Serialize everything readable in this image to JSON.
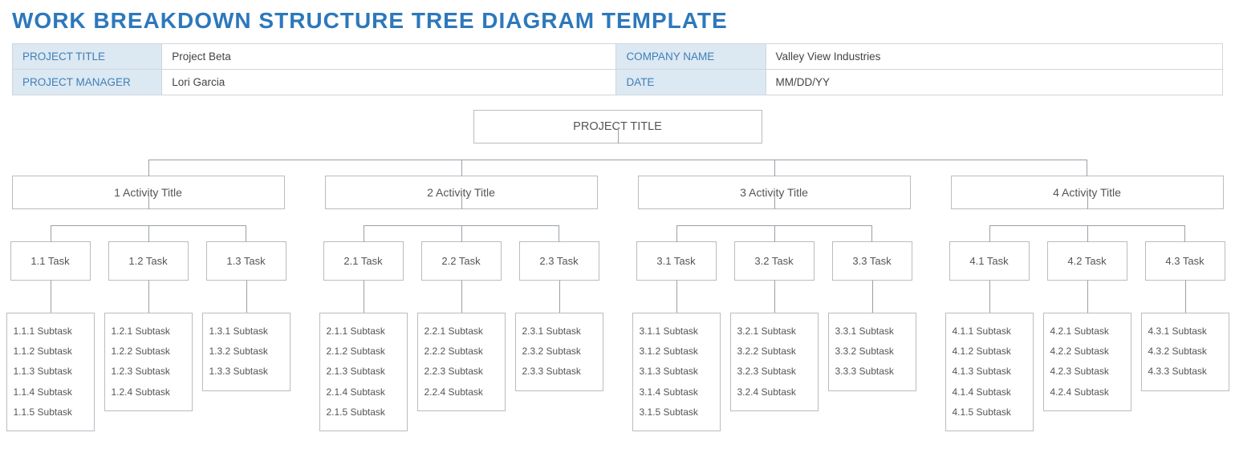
{
  "title": "WORK BREAKDOWN STRUCTURE TREE DIAGRAM TEMPLATE",
  "meta": {
    "project_title_label": "PROJECT TITLE",
    "project_title": "Project Beta",
    "company_name_label": "COMPANY NAME",
    "company_name": "Valley View Industries",
    "project_manager_label": "PROJECT MANAGER",
    "project_manager": "Lori Garcia",
    "date_label": "DATE",
    "date": "MM/DD/YY"
  },
  "tree": {
    "root": "PROJECT TITLE",
    "activities": [
      {
        "label": "1 Activity Title",
        "tasks": [
          {
            "label": "1.1 Task",
            "subtasks": [
              "1.1.1 Subtask",
              "1.1.2 Subtask",
              "1.1.3 Subtask",
              "1.1.4 Subtask",
              "1.1.5 Subtask"
            ]
          },
          {
            "label": "1.2 Task",
            "subtasks": [
              "1.2.1 Subtask",
              "1.2.2 Subtask",
              "1.2.3 Subtask",
              "1.2.4 Subtask"
            ]
          },
          {
            "label": "1.3 Task",
            "subtasks": [
              "1.3.1 Subtask",
              "1.3.2 Subtask",
              "1.3.3 Subtask"
            ]
          }
        ]
      },
      {
        "label": "2 Activity Title",
        "tasks": [
          {
            "label": "2.1 Task",
            "subtasks": [
              "2.1.1 Subtask",
              "2.1.2 Subtask",
              "2.1.3 Subtask",
              "2.1.4 Subtask",
              "2.1.5 Subtask"
            ]
          },
          {
            "label": "2.2 Task",
            "subtasks": [
              "2.2.1 Subtask",
              "2.2.2 Subtask",
              "2.2.3 Subtask",
              "2.2.4 Subtask"
            ]
          },
          {
            "label": "2.3 Task",
            "subtasks": [
              "2.3.1 Subtask",
              "2.3.2 Subtask",
              "2.3.3 Subtask"
            ]
          }
        ]
      },
      {
        "label": "3 Activity Title",
        "tasks": [
          {
            "label": "3.1 Task",
            "subtasks": [
              "3.1.1 Subtask",
              "3.1.2 Subtask",
              "3.1.3 Subtask",
              "3.1.4 Subtask",
              "3.1.5 Subtask"
            ]
          },
          {
            "label": "3.2 Task",
            "subtasks": [
              "3.2.1 Subtask",
              "3.2.2 Subtask",
              "3.2.3 Subtask",
              "3.2.4 Subtask"
            ]
          },
          {
            "label": "3.3 Task",
            "subtasks": [
              "3.3.1 Subtask",
              "3.3.2 Subtask",
              "3.3.3 Subtask"
            ]
          }
        ]
      },
      {
        "label": "4 Activity Title",
        "tasks": [
          {
            "label": "4.1 Task",
            "subtasks": [
              "4.1.1 Subtask",
              "4.1.2 Subtask",
              "4.1.3 Subtask",
              "4.1.4 Subtask",
              "4.1.5 Subtask"
            ]
          },
          {
            "label": "4.2 Task",
            "subtasks": [
              "4.2.1 Subtask",
              "4.2.2 Subtask",
              "4.2.3 Subtask",
              "4.2.4 Subtask"
            ]
          },
          {
            "label": "4.3 Task",
            "subtasks": [
              "4.3.1 Subtask",
              "4.3.2 Subtask",
              "4.3.3 Subtask"
            ]
          }
        ]
      }
    ]
  }
}
